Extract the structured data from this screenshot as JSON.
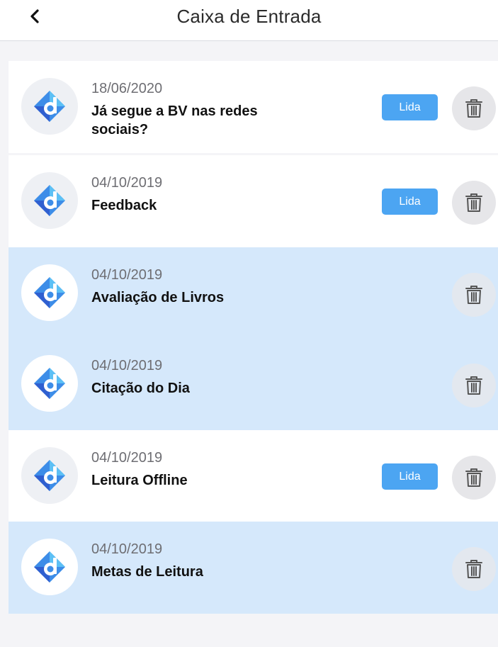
{
  "header": {
    "title": "Caixa de Entrada",
    "back_icon": "chevron-left-icon"
  },
  "colors": {
    "accent": "#4ca5f2",
    "unread_background": "#d5e8fb",
    "read_background": "#ffffff",
    "page_background": "#f4f4f7"
  },
  "messages": [
    {
      "date": "18/06/2020",
      "subject": "Já segue a BV nas redes sociais?",
      "badge": "Lida",
      "read": true
    },
    {
      "date": "04/10/2019",
      "subject": "Feedback",
      "badge": "Lida",
      "read": true
    },
    {
      "date": "04/10/2019",
      "subject": "Avaliação de Livros",
      "badge": "",
      "read": false
    },
    {
      "date": "04/10/2019",
      "subject": "Citação do Dia",
      "badge": "",
      "read": false
    },
    {
      "date": "04/10/2019",
      "subject": "Leitura Offline",
      "badge": "Lida",
      "read": true
    },
    {
      "date": "04/10/2019",
      "subject": "Metas de Leitura",
      "badge": "",
      "read": false
    }
  ],
  "icons": {
    "avatar": "bv-logo-icon",
    "delete": "trash-icon"
  }
}
